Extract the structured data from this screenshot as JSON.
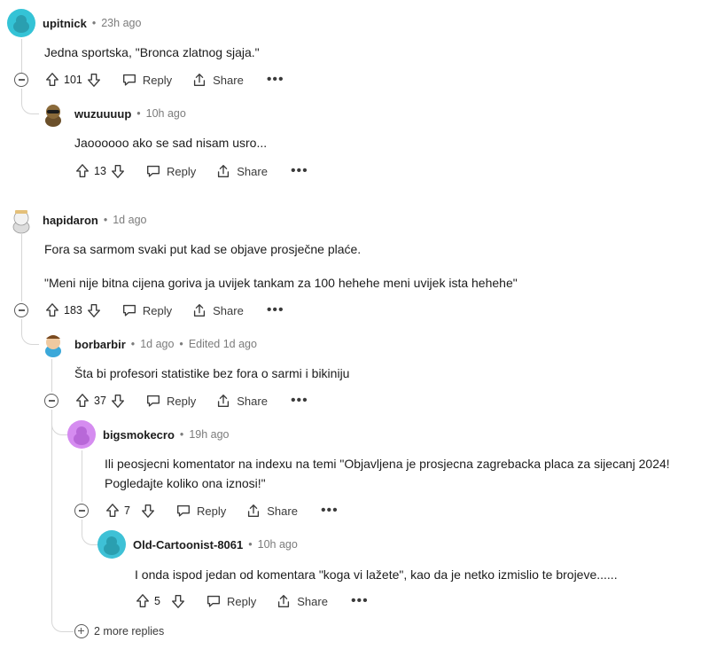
{
  "comments": [
    {
      "author": "upitnick",
      "time": "23h ago",
      "edited": "",
      "lines": [
        "Jedna sportska, \"Bronca zlatnog sjaja.\""
      ],
      "votes": "101",
      "avatar_color": "#34c3d6"
    },
    {
      "author": "wuzuuuup",
      "time": "10h ago",
      "edited": "",
      "lines": [
        "Jaoooooo ako se sad nisam usro..."
      ],
      "votes": "13",
      "avatar_color": "#6b4f2a"
    },
    {
      "author": "hapidaron",
      "time": "1d ago",
      "edited": "",
      "lines": [
        "Fora sa sarmom svaki put kad se objave prosječne plaće.",
        "\"Meni nije bitna cijena goriva ja uvijek tankam za 100 hehehe meni uvijek ista hehehe\""
      ],
      "votes": "183",
      "avatar_color": "#e8e8e8"
    },
    {
      "author": "borbarbir",
      "time": "1d ago",
      "edited": "Edited 1d ago",
      "lines": [
        "Šta bi profesori statistike bez fora o sarmi i bikiniju"
      ],
      "votes": "37",
      "avatar_color": "#3ba8d9"
    },
    {
      "author": "bigsmokecro",
      "time": "19h ago",
      "edited": "",
      "lines": [
        "Ili peosjecni komentator na indexu na temi \"Objavljena je prosjecna zagrebacka placa za sijecanj 2024!",
        "Pogledajte koliko ona iznosi!\""
      ],
      "votes": "7",
      "avatar_color": "#d58cf0"
    },
    {
      "author": "Old-Cartoonist-8061",
      "time": "10h ago",
      "edited": "",
      "lines": [
        "I onda ispod jedan od komentara \"koga vi lažete\", kao da je netko izmislio te brojeve......"
      ],
      "votes": "5",
      "avatar_color": "#3ec1d6"
    }
  ],
  "labels": {
    "reply": "Reply",
    "share": "Share",
    "more_replies": "2 more replies"
  },
  "meta_separator": "•"
}
